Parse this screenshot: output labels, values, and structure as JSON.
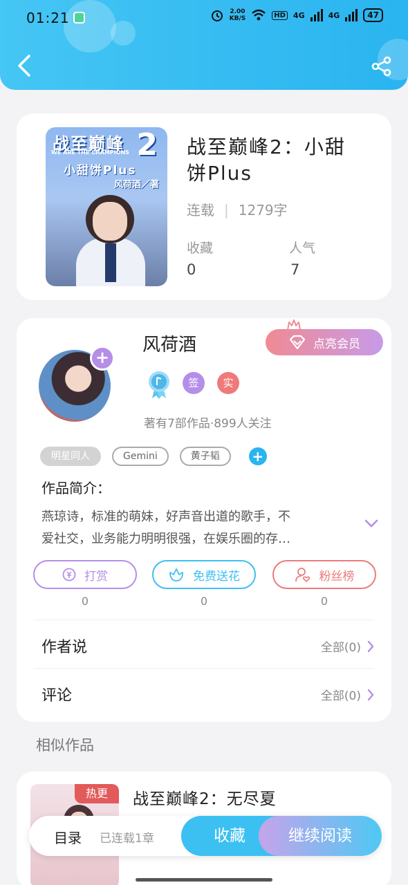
{
  "status_bar": {
    "time": "01:21",
    "speed_value": "2.00",
    "speed_unit": "KB/S",
    "hd_label": "HD",
    "network_1": "4G",
    "network_2": "4G",
    "battery": "47"
  },
  "header": {
    "back_icon": "chevron-left-icon",
    "share_icon": "share-icon",
    "accent_color": "#2ab4f0"
  },
  "book": {
    "cover": {
      "title": "战至巅峰",
      "number": "2",
      "subtitle": "WE ARE THE CHAMPIONS",
      "name": "小甜饼Plus",
      "author": "风荷酒／著"
    },
    "title": "战至巅峰2：小甜饼Plus",
    "status": "连载",
    "word_count": "1279字",
    "favorites_label": "收藏",
    "favorites_value": "0",
    "popularity_label": "人气",
    "popularity_value": "7"
  },
  "author": {
    "name": "风荷酒",
    "vip_button": "点亮会员",
    "badges": [
      "签",
      "实"
    ],
    "stats": "著有7部作品·899人关注",
    "tags": [
      "明星同人",
      "Gemini",
      "黄子韬"
    ],
    "intro_label": "作品简介：",
    "intro_line_1": "燕琼诗，标准的萌妹，好声音出道的歌手，不",
    "intro_line_2": "爱社交，业务能力明明很强，在娱乐圈的存…",
    "actions": [
      {
        "label": "打赏",
        "count": "0",
        "color": "#b58ee8",
        "icon": "coin-icon"
      },
      {
        "label": "免费送花",
        "count": "0",
        "color": "#3cc0f2",
        "icon": "flower-icon"
      },
      {
        "label": "粉丝榜",
        "count": "0",
        "color": "#ee7a7a",
        "icon": "fans-icon"
      }
    ],
    "author_says_label": "作者说",
    "author_says_all": "全部(0)",
    "comments_label": "评论",
    "comments_all": "全部(0)"
  },
  "similar": {
    "section_title": "相似作品",
    "items": [
      {
        "title": "战至巅峰2：无尽夏",
        "badge": "热更"
      }
    ]
  },
  "bottom_bar": {
    "toc_label": "目录",
    "toc_status": "已连载1章",
    "collect_label": "收藏",
    "read_label": "继续阅读"
  }
}
